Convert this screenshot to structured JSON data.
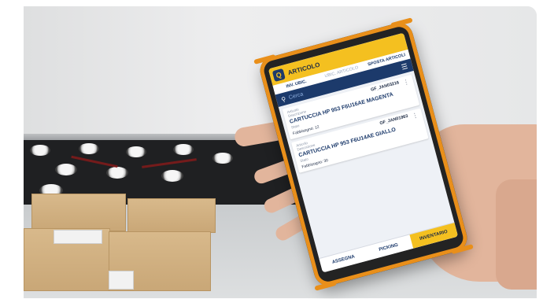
{
  "app": {
    "header_title": "ARTICOLO",
    "logo_letter": "Q"
  },
  "tabs": [
    {
      "label": "INV. UBIC."
    },
    {
      "label": "UBIC. ARTICOLO"
    },
    {
      "label": "SPOSTA ARTICOLI"
    }
  ],
  "search": {
    "placeholder": "Cerca"
  },
  "items": [
    {
      "field_label": "Articolo",
      "code": "GF_JAN03216",
      "desc_label": "Descrizione",
      "description": "CARTUCCIA HP 953 F6U16AE MAGENTA",
      "status": "Stato",
      "qty": "Fabbisogno: 12"
    },
    {
      "field_label": "Articolo",
      "code": "GF_JAN01963",
      "desc_label": "Descrizione",
      "description": "CARTUCCIA HP 953 F6U14AE GIALLO",
      "status": "Stato",
      "qty": "Fabbisogno: 30"
    }
  ],
  "bottom_nav": [
    {
      "label": "ASSEGNA"
    },
    {
      "label": "PICKING"
    },
    {
      "label": "INVENTARIO"
    }
  ],
  "colors": {
    "accent_yellow": "#f4c020",
    "navy": "#1c3a6b",
    "bumper_orange": "#e98f1a"
  }
}
